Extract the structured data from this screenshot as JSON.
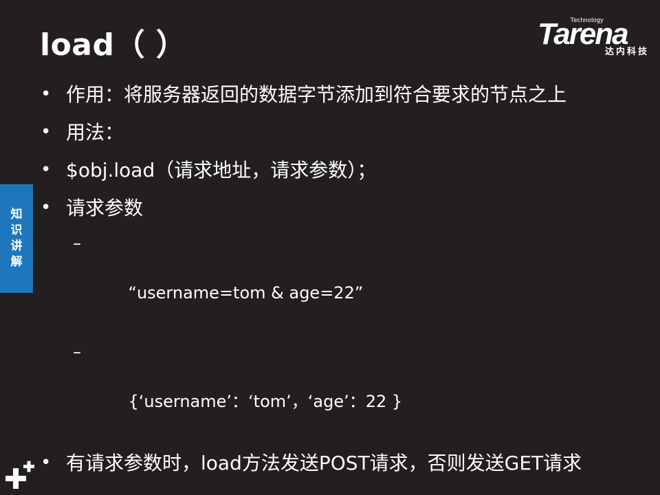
{
  "slide": {
    "title": "load（ ）"
  },
  "logo": {
    "tech": "Technology",
    "name": "Tarena",
    "subtitle": "达内科技"
  },
  "side_tab": {
    "chars": [
      "知",
      "识",
      "讲",
      "解"
    ],
    "color": "#1e77bd"
  },
  "bullets": [
    {
      "text": "作用：将服务器返回的数据字节添加到符合要求的节点之上"
    },
    {
      "text": "用法："
    },
    {
      "text": "$obj.load（请求地址，请求参数）；"
    },
    {
      "text": "请求参数"
    }
  ],
  "sub_items": [
    {
      "text": "“username=tom & age=22”"
    },
    {
      "text": "{‘username’：‘tom’，‘age’：22 }"
    }
  ],
  "final_bullet": {
    "text": "有请求参数时，load方法发送POST请求，否则发送GET请求"
  },
  "bullet_glyph": "•",
  "dash_glyph": "–",
  "colors": {
    "background": "#231f20",
    "text": "#ffffff",
    "accent": "#1e77bd"
  }
}
